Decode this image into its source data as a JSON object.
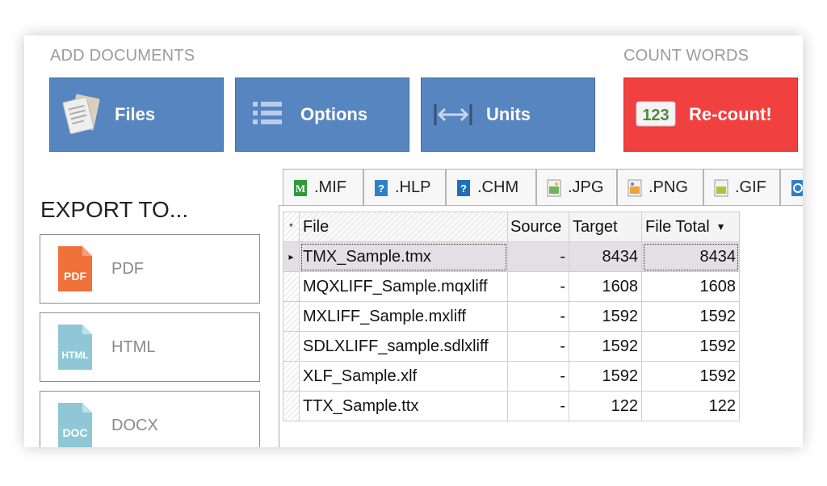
{
  "sections": {
    "add_documents": "ADD DOCUMENTS",
    "count_words": "COUNT WORDS"
  },
  "buttons": {
    "files": "Files",
    "options": "Options",
    "units": "Units",
    "recount": "Re-count!",
    "recount_icon_text": "123"
  },
  "colors": {
    "button_blue": "#5785c0",
    "recount_red": "#f04040",
    "pdf_orange": "#f0713a",
    "doc_blue": "#8fc7d6"
  },
  "export": {
    "title": "EXPORT TO...",
    "items": [
      {
        "label": "PDF",
        "icon_text": "PDF",
        "icon": "pdf-file-icon"
      },
      {
        "label": "HTML",
        "icon_text": "HTML",
        "icon": "html-file-icon"
      },
      {
        "label": "DOCX",
        "icon_text": "DOC",
        "icon": "docx-file-icon"
      }
    ]
  },
  "tabs": [
    {
      "label": ".MIF",
      "icon": "mif-file-icon"
    },
    {
      "label": ".HLP",
      "icon": "help-file-icon"
    },
    {
      "label": ".CHM",
      "icon": "chm-file-icon"
    },
    {
      "label": ".JPG",
      "icon": "jpg-file-icon"
    },
    {
      "label": ".PNG",
      "icon": "png-file-icon"
    },
    {
      "label": ".GIF",
      "icon": "gif-file-icon"
    }
  ],
  "grid": {
    "header_marker": "*",
    "row_marker": "▸",
    "columns": [
      "File",
      "Source",
      "Target",
      "File Total"
    ],
    "rows": [
      {
        "file": "TMX_Sample.tmx",
        "source": "-",
        "target": "8434",
        "total": "8434"
      },
      {
        "file": "MQXLIFF_Sample.mqxliff",
        "source": "-",
        "target": "1608",
        "total": "1608"
      },
      {
        "file": "MXLIFF_Sample.mxliff",
        "source": "-",
        "target": "1592",
        "total": "1592"
      },
      {
        "file": "SDLXLIFF_sample.sdlxliff",
        "source": "-",
        "target": "1592",
        "total": "1592"
      },
      {
        "file": "XLF_Sample.xlf",
        "source": "-",
        "target": "1592",
        "total": "1592"
      },
      {
        "file": "TTX_Sample.ttx",
        "source": "-",
        "target": "122",
        "total": "122"
      }
    ]
  }
}
